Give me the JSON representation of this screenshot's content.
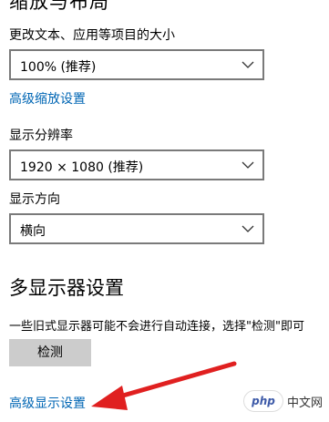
{
  "partial_heading": "缩放与布局",
  "scale": {
    "label": "更改文本、应用等项目的大小",
    "value": "100% (推荐)",
    "advanced_link": "高级缩放设置"
  },
  "resolution": {
    "label": "显示分辨率",
    "value": "1920 × 1080 (推荐)"
  },
  "orientation": {
    "label": "显示方向",
    "value": "横向"
  },
  "multi_display": {
    "heading": "多显示器设置",
    "description": "一些旧式显示器可能不会进行自动连接，选择\"检测\"即可",
    "detect_button": "检测"
  },
  "advanced_display_link": "高级显示设置",
  "watermark": {
    "logo": "php",
    "text": "中文网"
  },
  "colors": {
    "link": "#0066b4",
    "arrow": "#e02020",
    "button_bg": "#cccccc",
    "dropdown_border": "#7a7a7a"
  }
}
